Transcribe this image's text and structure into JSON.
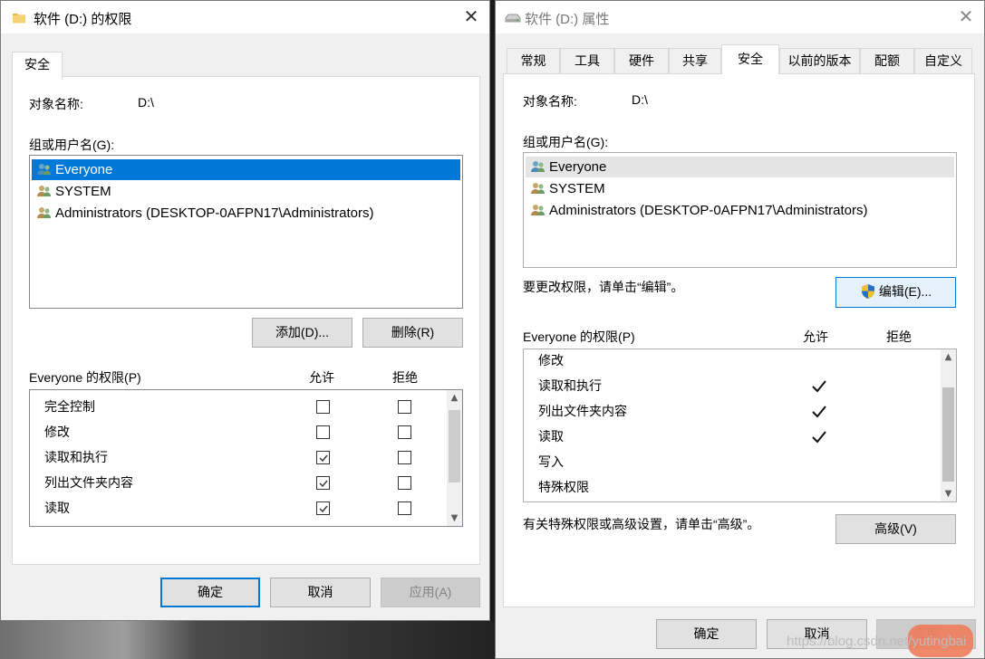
{
  "left_dialog": {
    "title": "软件 (D:) 的权限",
    "tab": "安全",
    "object_name_label": "对象名称:",
    "object_name_value": "D:\\",
    "group_label": "组或用户名(G):",
    "users": [
      "Everyone",
      "SYSTEM",
      "Administrators (DESKTOP-0AFPN17\\Administrators)"
    ],
    "add_button": "添加(D)...",
    "remove_button": "删除(R)",
    "perm_label": "Everyone 的权限(P)",
    "allow_header": "允许",
    "deny_header": "拒绝",
    "permissions": [
      {
        "name": "完全控制",
        "allow": false,
        "deny": false
      },
      {
        "name": "修改",
        "allow": false,
        "deny": false
      },
      {
        "name": "读取和执行",
        "allow": true,
        "deny": false
      },
      {
        "name": "列出文件夹内容",
        "allow": true,
        "deny": false
      },
      {
        "name": "读取",
        "allow": true,
        "deny": false
      }
    ],
    "ok_button": "确定",
    "cancel_button": "取消",
    "apply_button": "应用(A)"
  },
  "right_dialog": {
    "title": "软件 (D:) 属性",
    "tabs": [
      "常规",
      "工具",
      "硬件",
      "共享",
      "安全",
      "以前的版本",
      "配额",
      "自定义"
    ],
    "active_tab": "安全",
    "object_name_label": "对象名称:",
    "object_name_value": "D:\\",
    "group_label": "组或用户名(G):",
    "users": [
      "Everyone",
      "SYSTEM",
      "Administrators (DESKTOP-0AFPN17\\Administrators)"
    ],
    "edit_hint": "要更改权限，请单击“编辑”。",
    "edit_button": "编辑(E)...",
    "perm_label": "Everyone 的权限(P)",
    "allow_header": "允许",
    "deny_header": "拒绝",
    "permissions": [
      {
        "name": "修改",
        "allow": false
      },
      {
        "name": "读取和执行",
        "allow": true
      },
      {
        "name": "列出文件夹内容",
        "allow": true
      },
      {
        "name": "读取",
        "allow": true
      },
      {
        "name": "写入",
        "allow": false
      },
      {
        "name": "特殊权限",
        "allow": false
      }
    ],
    "advanced_hint": "有关特殊权限或高级设置，请单击“高级”。",
    "advanced_button": "高级(V)",
    "ok_button": "确定",
    "cancel_button": "取消",
    "apply_button": "应用"
  },
  "watermark": "https://blog.csdn.net/yutingbai"
}
